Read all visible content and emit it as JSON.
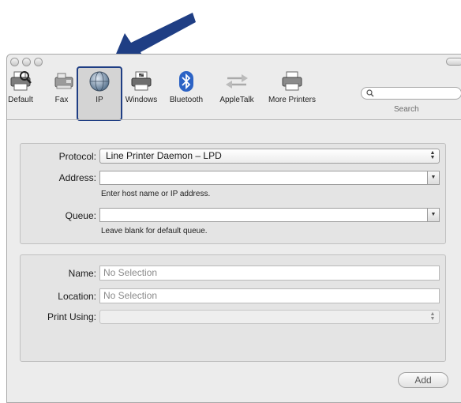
{
  "toolbar": {
    "items": [
      {
        "label": "Default",
        "icon": "default-printer-icon"
      },
      {
        "label": "Fax",
        "icon": "fax-icon"
      },
      {
        "label": "IP",
        "icon": "globe-icon"
      },
      {
        "label": "Windows",
        "icon": "windows-printer-icon"
      },
      {
        "label": "Bluetooth",
        "icon": "bluetooth-icon"
      },
      {
        "label": "AppleTalk",
        "icon": "appletalk-icon"
      },
      {
        "label": "More Printers",
        "icon": "more-printers-icon"
      }
    ],
    "selected": "IP",
    "search_label": "Search",
    "search_placeholder": ""
  },
  "connection": {
    "protocol_label": "Protocol:",
    "protocol_value": "Line Printer Daemon – LPD",
    "address_label": "Address:",
    "address_value": "",
    "address_hint": "Enter host name or IP address.",
    "queue_label": "Queue:",
    "queue_value": "",
    "queue_hint": "Leave blank for default queue."
  },
  "printer": {
    "name_label": "Name:",
    "name_value": "No Selection",
    "location_label": "Location:",
    "location_value": "No Selection",
    "print_using_label": "Print Using:",
    "print_using_value": ""
  },
  "add_button": "Add",
  "colors": {
    "callout_arrow": "#1f3e84",
    "window_bg": "#ececec",
    "selection_border": "#1f3e84"
  }
}
